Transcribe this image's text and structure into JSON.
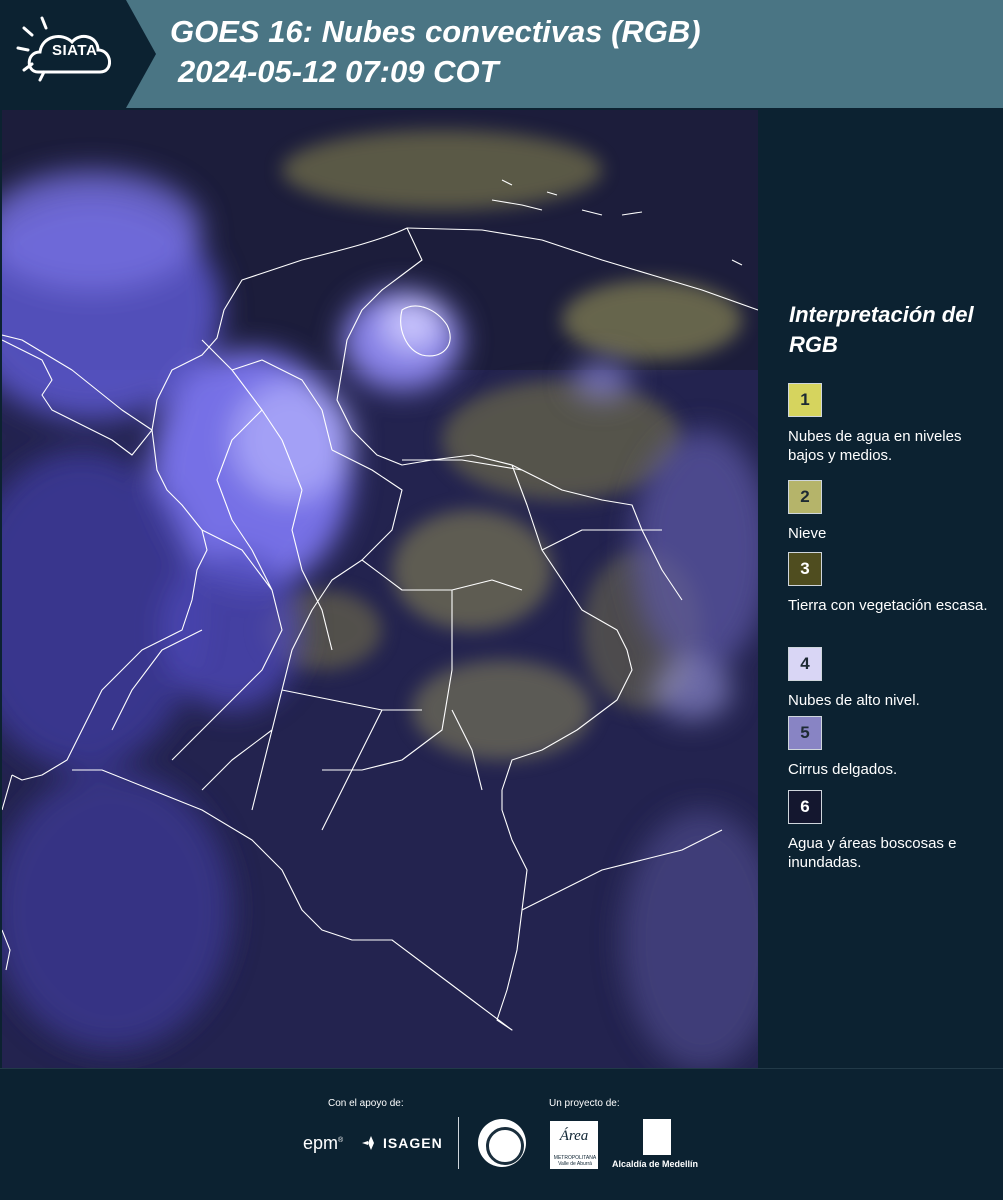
{
  "header": {
    "logo_text": "SIATA",
    "title_line1": "GOES 16: Nubes convectivas (RGB)",
    "title_line2": "2024-05-12 07:09 COT"
  },
  "legend": {
    "title": "Interpretación del RGB",
    "items": [
      {
        "number": "1",
        "label": "Nubes de agua en niveles bajos y medios.",
        "color": "#d6d45e"
      },
      {
        "number": "2",
        "label": "Nieve",
        "color": "#b5b46a"
      },
      {
        "number": "3",
        "label": "Tierra con vegetación escasa.",
        "color": "#4f4d1f"
      },
      {
        "number": "4",
        "label": "Nubes de alto nivel.",
        "color": "#d9d6f5"
      },
      {
        "number": "5",
        "label": "Cirrus delgados.",
        "color": "#8884c4"
      },
      {
        "number": "6",
        "label": "Agua y áreas boscosas e inundadas.",
        "color": "#14172f"
      }
    ]
  },
  "footer": {
    "support_label": "Con el apoyo de:",
    "project_label": "Un proyecto de:",
    "sponsor1": "epm",
    "sponsor2": "ISAGEN",
    "partner_area": "Área",
    "partner_area_sub": "METROPOLITANA Valle de Aburrá",
    "partner_alcaldia": "Alcaldía de Medellín"
  },
  "colors": {
    "header_bg": "#4a7584",
    "panel_bg": "#0c2231",
    "map_base": "#23234f",
    "convective_cloud": "#6b63e8",
    "low_cloud": "#c9c46a",
    "border_lines": "#ffffff"
  }
}
